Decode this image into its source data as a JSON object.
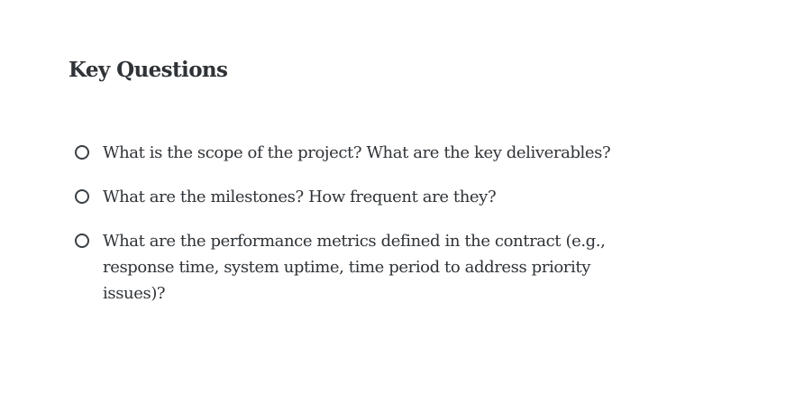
{
  "section": {
    "title": "Key Questions"
  },
  "questions": [
    {
      "text": "What is the scope of the project? What are the key deliverables?",
      "checked": false
    },
    {
      "text": "What are the milestones? How frequent are they?",
      "checked": false
    },
    {
      "text": "What are the performance metrics defined in the contract (e.g., response time, system uptime, time period to address priority issues)?",
      "checked": false
    }
  ]
}
